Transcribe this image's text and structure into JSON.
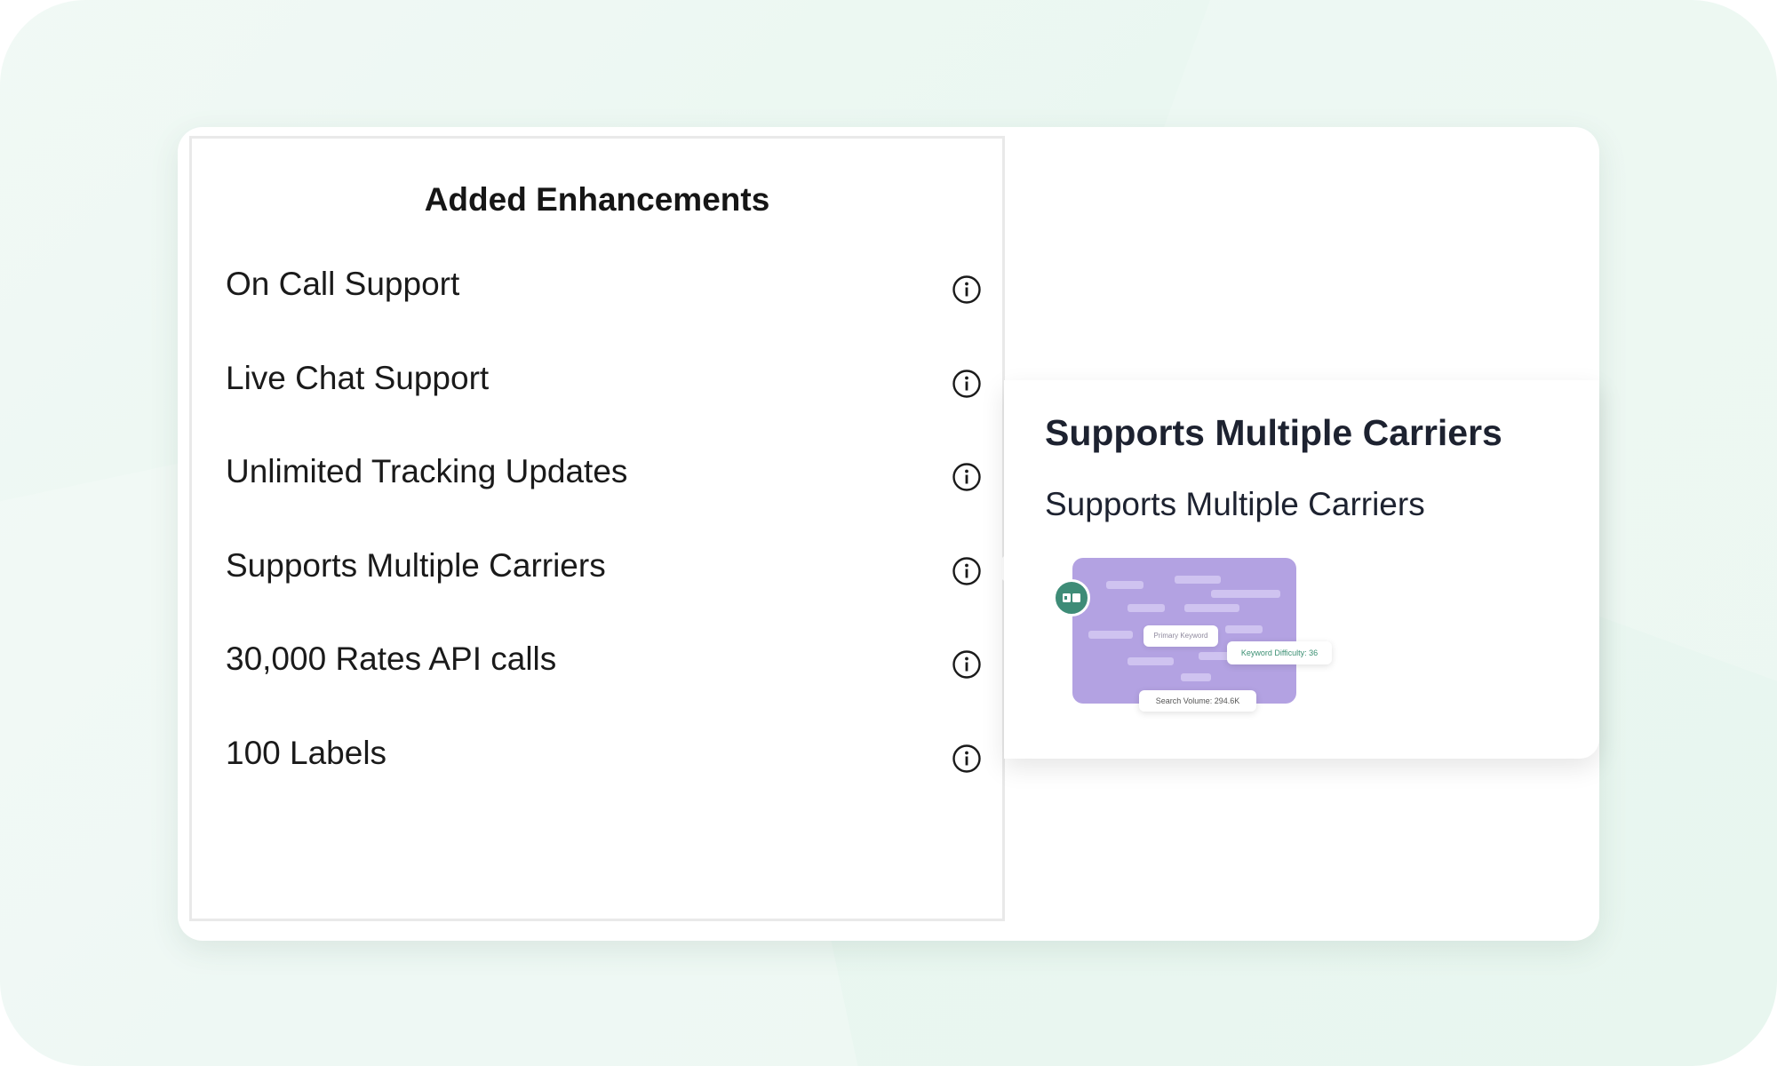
{
  "panel": {
    "title": "Added Enhancements",
    "features": [
      {
        "label": "On Call Support"
      },
      {
        "label": "Live Chat Support"
      },
      {
        "label": "Unlimited Tracking Updates"
      },
      {
        "label": "Supports Multiple Carriers"
      },
      {
        "label": "30,000 Rates API calls"
      },
      {
        "label": "100 Labels"
      }
    ]
  },
  "tooltip": {
    "title": "Supports Multiple Carriers",
    "description": "Supports Multiple Carriers",
    "illustration": {
      "primary_keyword": "Primary Keyword",
      "keyword_difficulty": "Keyword Difficulty: 36",
      "search_volume": "Search Volume:  294.6K"
    }
  },
  "colors": {
    "background": "#eaf7f1",
    "illustration_card": "#b3a2e2",
    "badge": "#3e8c77",
    "keyword_difficulty_text": "#3a8f72"
  }
}
